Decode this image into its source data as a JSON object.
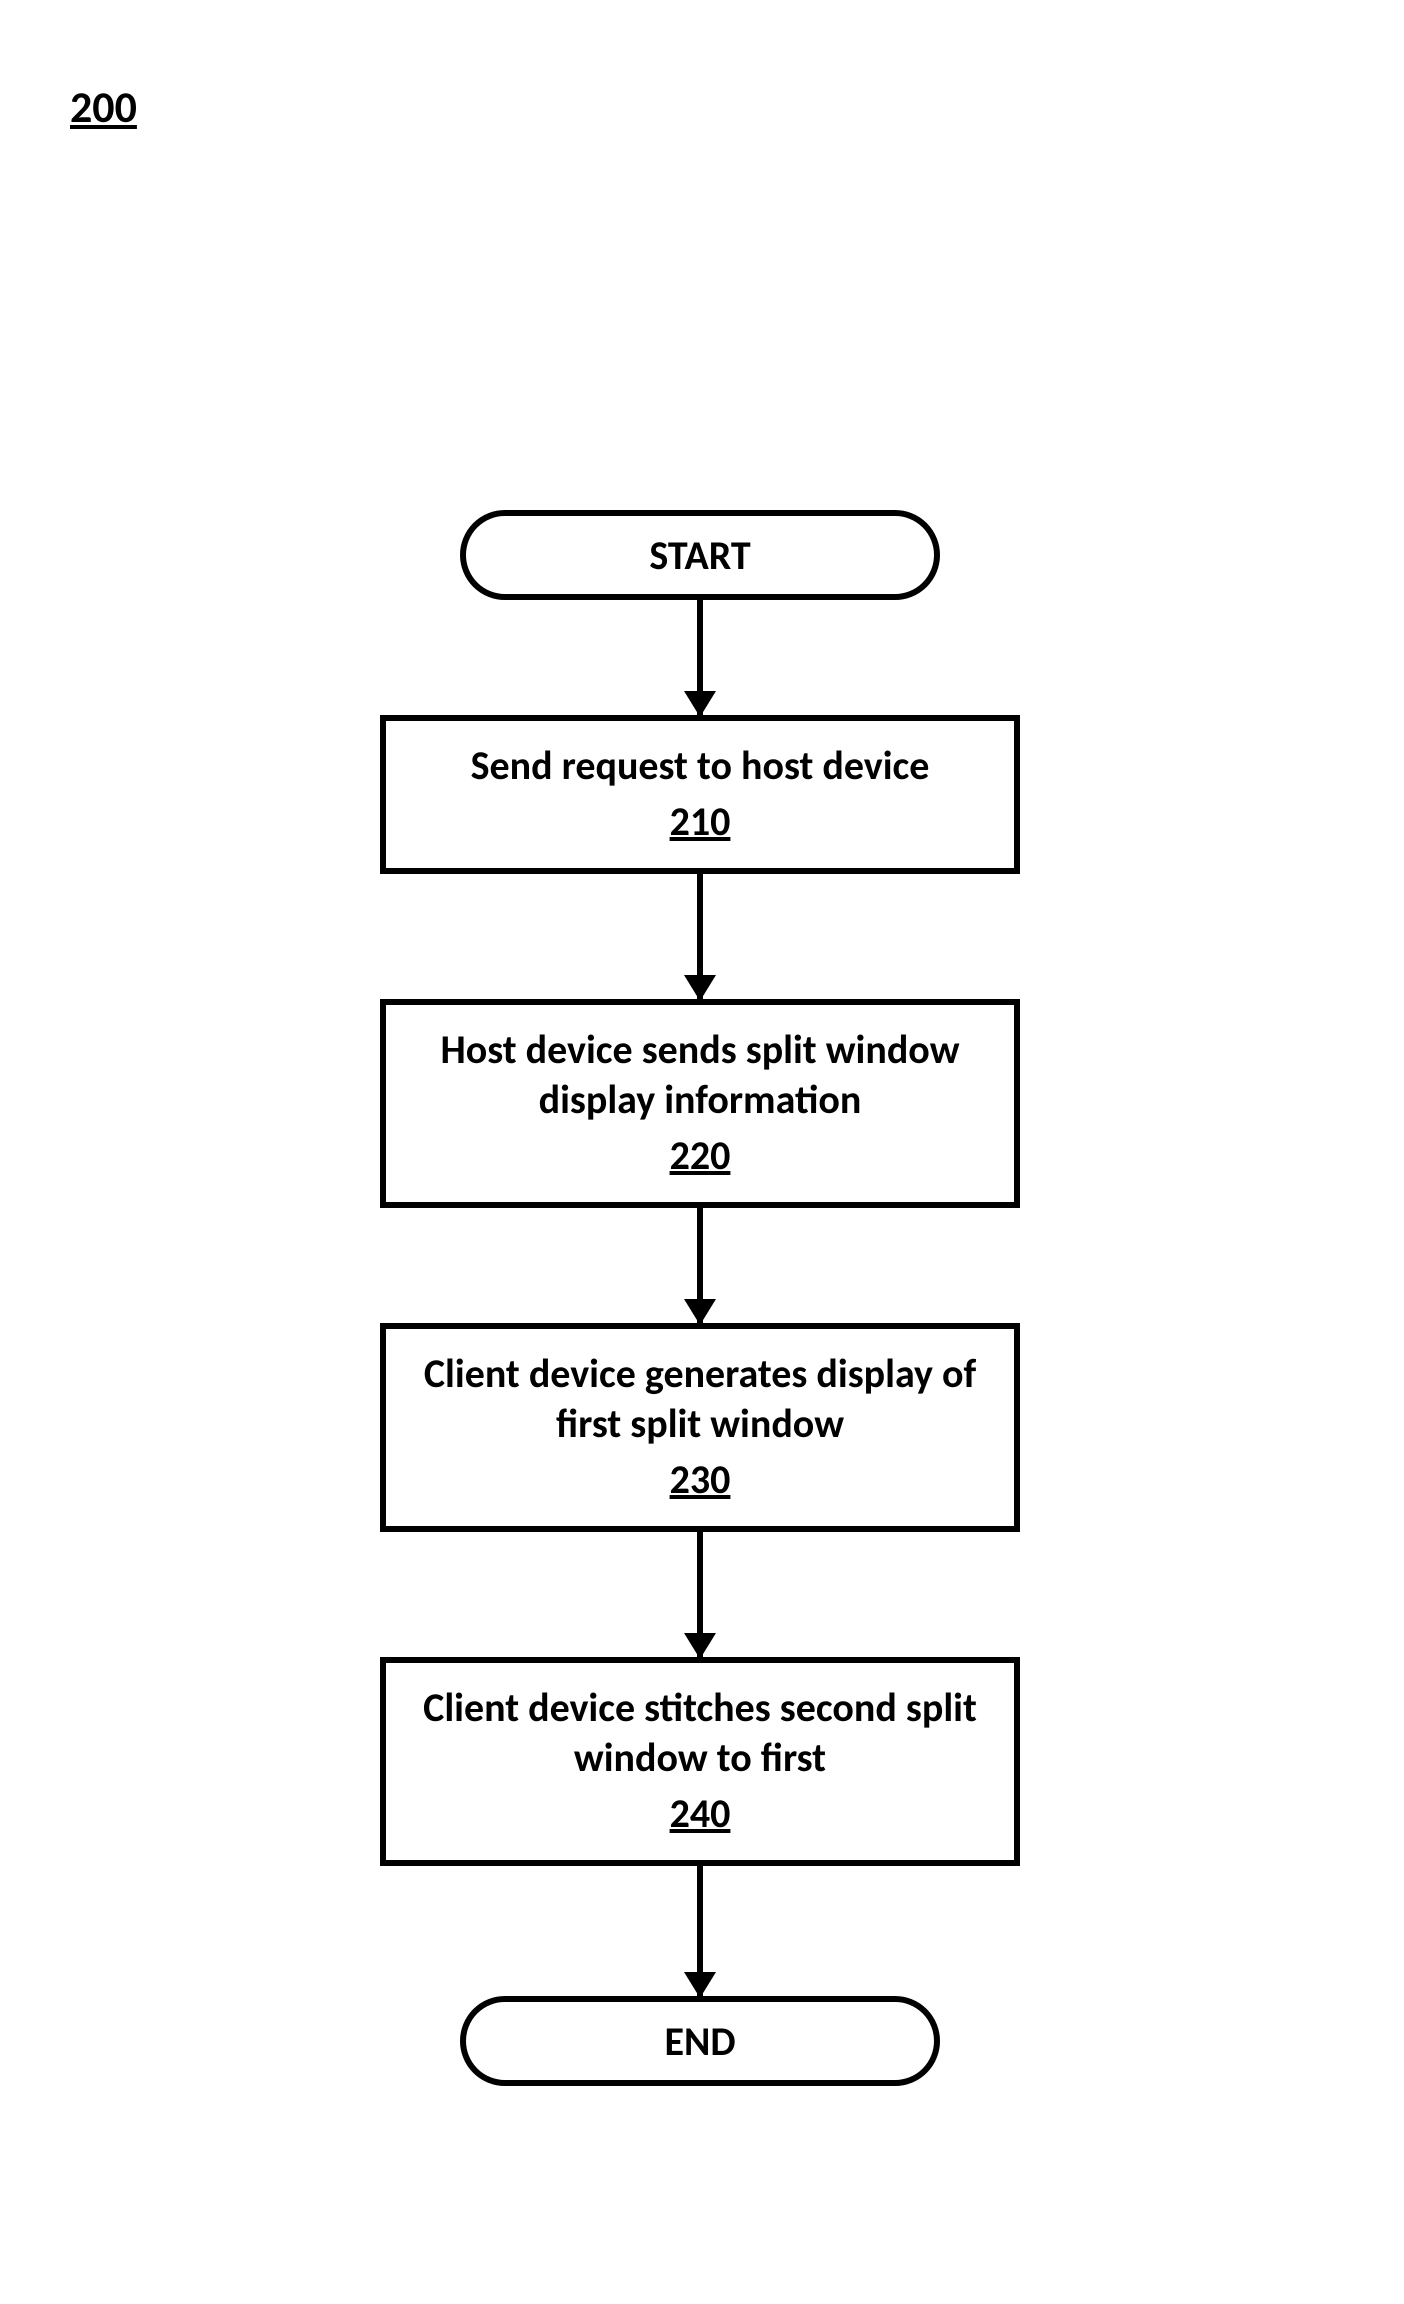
{
  "figure_number": "200",
  "flowchart": {
    "start": "START",
    "end": "END",
    "steps": [
      {
        "text": "Send request to host device",
        "ref": "210"
      },
      {
        "text": "Host device sends split window display information",
        "ref": "220"
      },
      {
        "text": "Client device generates display of first split window",
        "ref": "230"
      },
      {
        "text": "Client device stitches second split window to first",
        "ref": "240"
      }
    ]
  }
}
